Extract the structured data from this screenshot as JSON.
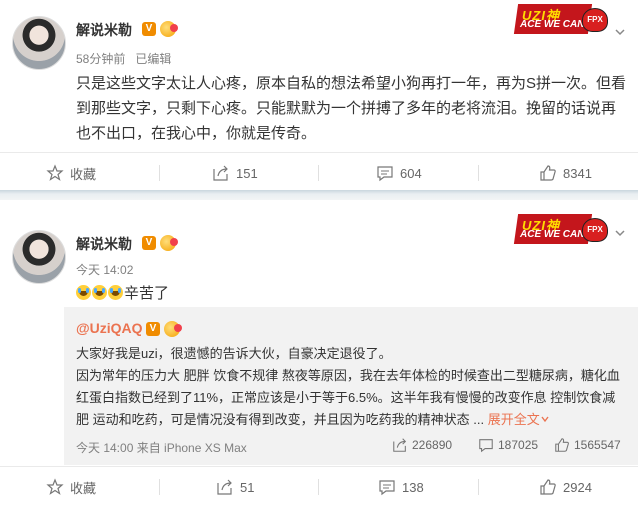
{
  "posts": [
    {
      "author": "解说米勒",
      "time": "58分钟前",
      "edited": "已编辑",
      "text": "只是这些文字太让人心疼，原本自私的想法希望小狗再打一年，再为S拼一次。但看到那些文字，只剩下心疼。只能默默为一个拼搏了多年的老将流泪。挽留的话说再也不出口，在我心中，你就是传奇。",
      "sticker": {
        "line1": "UZI神",
        "line2": "ACE WE CAN",
        "logo": "FPX"
      },
      "actions": {
        "favorite": "收藏",
        "repost": "151",
        "comment": "604",
        "like": "8341"
      }
    },
    {
      "author": "解说米勒",
      "time": "今天 14:02",
      "text": "辛苦了",
      "sticker": {
        "line1": "UZI神",
        "line2": "ACE WE CAN",
        "logo": "FPX"
      },
      "quote": {
        "author": "@UziQAQ",
        "text_p1": "大家好我是uzi，很遗憾的告诉大伙，自豪决定退役了。",
        "text_p2": "因为常年的压力大 肥胖 饮食不规律 熬夜等原因，我在去年体检的时候查出二型糖尿病，糖化血红蛋白指数已经到了11%，正常应该是小于等于6.5%。这半年我有慢慢的改变作息 控制饮食减肥 运动和吃药，可是情况没有得到改变，并且因为吃药我的精神状态 ...",
        "expand": "展开全文",
        "meta": "今天 14:00 来自 iPhone XS Max",
        "repost": "226890",
        "comment": "187025",
        "like": "1565547"
      },
      "actions": {
        "favorite": "收藏",
        "repost": "51",
        "comment": "138",
        "like": "2924"
      }
    }
  ],
  "colors": {
    "link": "#eb7350",
    "vip": "#f08c00",
    "muted": "#808080"
  }
}
